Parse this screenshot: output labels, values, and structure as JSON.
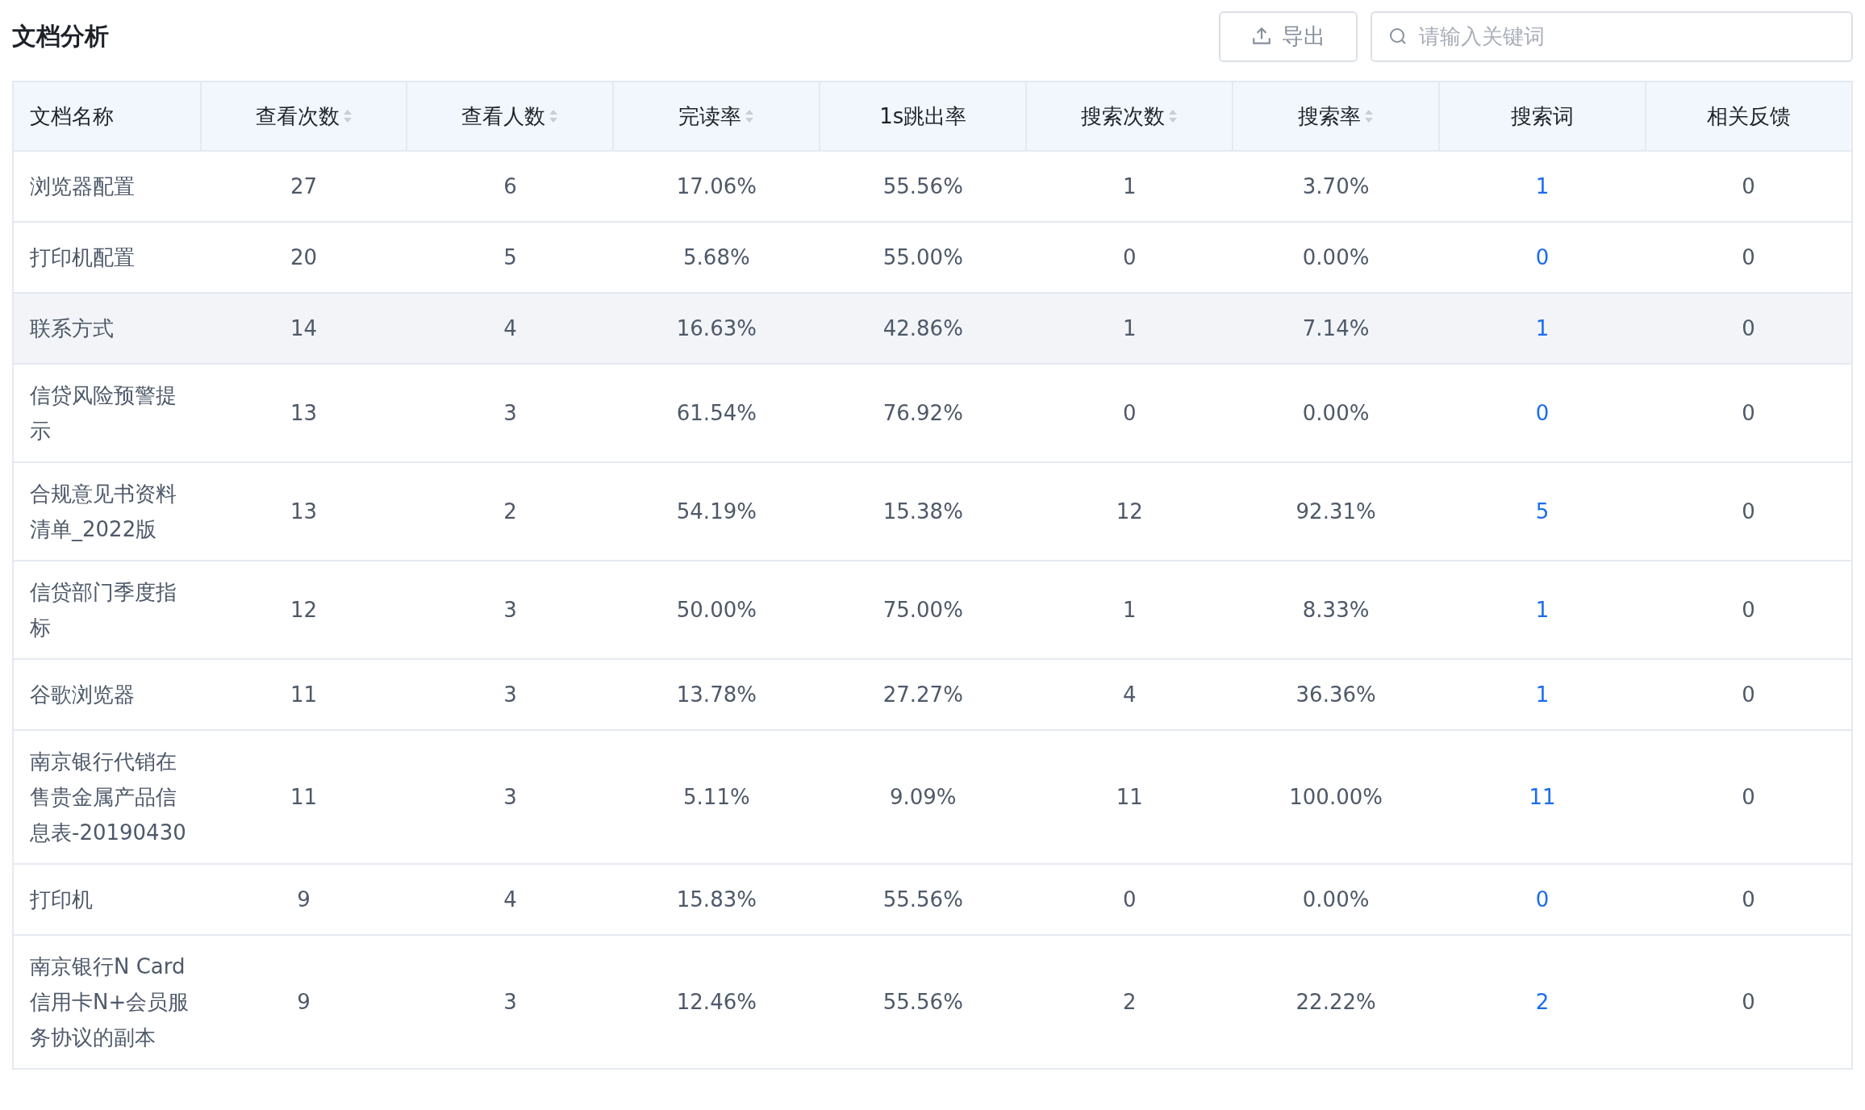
{
  "title": "文档分析",
  "toolbar": {
    "export_button": "导出",
    "search": {
      "placeholder": "请输入关键词"
    }
  },
  "table": {
    "columns": [
      {
        "label": "文档名称",
        "sortable": false,
        "kind": "text"
      },
      {
        "label": "查看次数",
        "sortable": true,
        "kind": "text"
      },
      {
        "label": "查看人数",
        "sortable": true,
        "kind": "text"
      },
      {
        "label": "完读率",
        "sortable": true,
        "kind": "text"
      },
      {
        "label": "1s跳出率",
        "sortable": false,
        "kind": "text"
      },
      {
        "label": "搜索次数",
        "sortable": true,
        "kind": "text"
      },
      {
        "label": "搜索率",
        "sortable": true,
        "kind": "text"
      },
      {
        "label": "搜索词",
        "sortable": false,
        "kind": "link"
      },
      {
        "label": "相关反馈",
        "sortable": false,
        "kind": "text"
      }
    ],
    "rows": [
      {
        "highlighted": false,
        "cells": [
          "浏览器配置",
          "27",
          "6",
          "17.06%",
          "55.56%",
          "1",
          "3.70%",
          "1",
          "0"
        ]
      },
      {
        "highlighted": false,
        "cells": [
          "打印机配置",
          "20",
          "5",
          "5.68%",
          "55.00%",
          "0",
          "0.00%",
          "0",
          "0"
        ]
      },
      {
        "highlighted": true,
        "cells": [
          "联系方式",
          "14",
          "4",
          "16.63%",
          "42.86%",
          "1",
          "7.14%",
          "1",
          "0"
        ]
      },
      {
        "highlighted": false,
        "cells": [
          "信贷风险预警提示",
          "13",
          "3",
          "61.54%",
          "76.92%",
          "0",
          "0.00%",
          "0",
          "0"
        ]
      },
      {
        "highlighted": false,
        "cells": [
          "合规意见书资料清单_2022版",
          "13",
          "2",
          "54.19%",
          "15.38%",
          "12",
          "92.31%",
          "5",
          "0"
        ]
      },
      {
        "highlighted": false,
        "cells": [
          "信贷部门季度指标",
          "12",
          "3",
          "50.00%",
          "75.00%",
          "1",
          "8.33%",
          "1",
          "0"
        ]
      },
      {
        "highlighted": false,
        "cells": [
          "谷歌浏览器",
          "11",
          "3",
          "13.78%",
          "27.27%",
          "4",
          "36.36%",
          "1",
          "0"
        ]
      },
      {
        "highlighted": false,
        "cells": [
          "南京银行代销在售贵金属产品信息表-20190430",
          "11",
          "3",
          "5.11%",
          "9.09%",
          "11",
          "100.00%",
          "11",
          "0"
        ]
      },
      {
        "highlighted": false,
        "cells": [
          "打印机",
          "9",
          "4",
          "15.83%",
          "55.56%",
          "0",
          "0.00%",
          "0",
          "0"
        ]
      },
      {
        "highlighted": false,
        "cells": [
          "南京银行N Card信用卡N+会员服务协议的副本",
          "9",
          "3",
          "12.46%",
          "55.56%",
          "2",
          "22.22%",
          "2",
          "0"
        ]
      }
    ]
  }
}
